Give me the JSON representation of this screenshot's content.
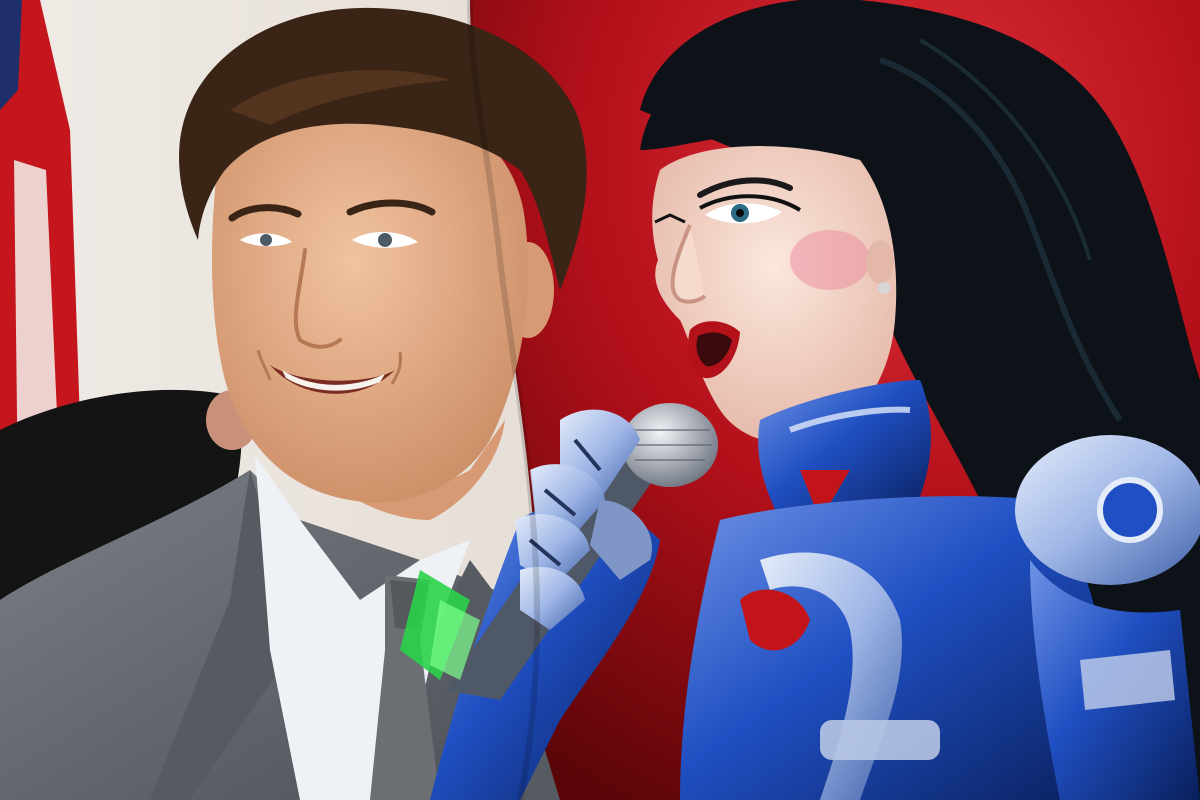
{
  "image": {
    "kind": "photo-composite",
    "subjects": [],
    "palette": {
      "left_background": "#e9e2da",
      "right_background": "#b3101a",
      "suit": "#5f646b",
      "shirt": "#eef2f6",
      "tie": "#6b6e72",
      "skin_left": "#e6b08c",
      "hair_left": "#3a2416",
      "skin_right": "#f1d6c8",
      "hair_right": "#0c1217",
      "armor_blue": "#1f4fc2",
      "armor_chrome": "#9fb6e6",
      "armor_red": "#c3141a",
      "lips": "#b3121b",
      "flag_red": "#c4161c",
      "flag_blue": "#1e2f6b",
      "microphone": "#c9ced6",
      "mic_green": "#2ad14a"
    }
  }
}
